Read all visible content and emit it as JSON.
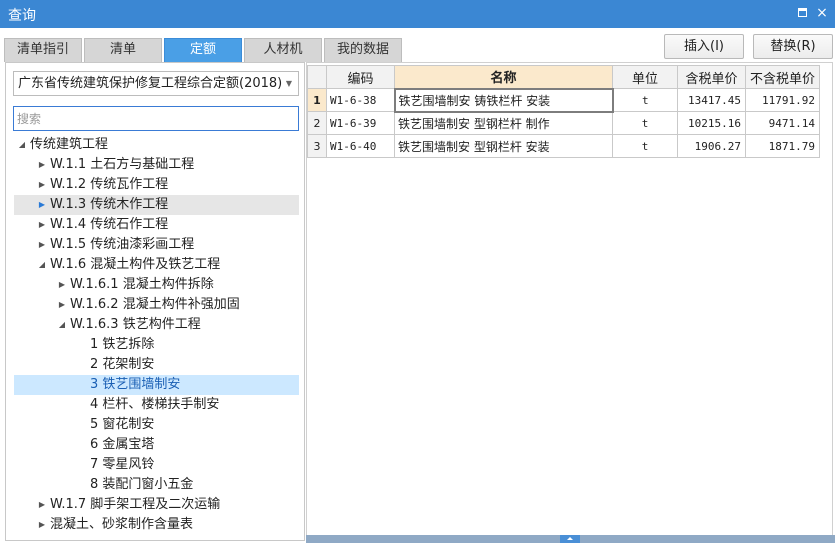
{
  "window": {
    "title": "查询",
    "close_glyph": "×"
  },
  "tabs": [
    {
      "label": "清单指引"
    },
    {
      "label": "清单"
    },
    {
      "label": "定额",
      "active": true
    },
    {
      "label": "人材机"
    },
    {
      "label": "我的数据"
    }
  ],
  "actions": {
    "insert_label": "插入(I)",
    "replace_label": "替换(R)"
  },
  "left": {
    "library": "广东省传统建筑保护修复工程综合定额(2018)",
    "search_placeholder": "搜索"
  },
  "tree": [
    {
      "label": "传统建筑工程",
      "level": 0,
      "state": "expanded"
    },
    {
      "label": "W.1.1 土石方与基础工程",
      "level": 1,
      "state": "collapsed"
    },
    {
      "label": "W.1.2 传统瓦作工程",
      "level": 1,
      "state": "collapsed"
    },
    {
      "label": "W.1.3 传统木作工程",
      "level": 1,
      "state": "collapsed-hover"
    },
    {
      "label": "W.1.4 传统石作工程",
      "level": 1,
      "state": "collapsed"
    },
    {
      "label": "W.1.5 传统油漆彩画工程",
      "level": 1,
      "state": "collapsed"
    },
    {
      "label": "W.1.6 混凝土构件及铁艺工程",
      "level": 1,
      "state": "expanded"
    },
    {
      "label": "W.1.6.1 混凝土构件拆除",
      "level": 2,
      "state": "collapsed"
    },
    {
      "label": "W.1.6.2 混凝土构件补强加固",
      "level": 2,
      "state": "collapsed"
    },
    {
      "label": "W.1.6.3 铁艺构件工程",
      "level": 2,
      "state": "expanded"
    },
    {
      "label": "1 铁艺拆除",
      "level": 3,
      "state": "leaf"
    },
    {
      "label": "2 花架制安",
      "level": 3,
      "state": "leaf"
    },
    {
      "label": "3 铁艺围墙制安",
      "level": 3,
      "state": "selected"
    },
    {
      "label": "4 栏杆、楼梯扶手制安",
      "level": 3,
      "state": "leaf"
    },
    {
      "label": "5 窗花制安",
      "level": 3,
      "state": "leaf"
    },
    {
      "label": "6 金属宝塔",
      "level": 3,
      "state": "leaf"
    },
    {
      "label": "7 零星风铃",
      "level": 3,
      "state": "leaf"
    },
    {
      "label": "8 装配门窗小五金",
      "level": 3,
      "state": "leaf"
    },
    {
      "label": "W.1.7 脚手架工程及二次运输",
      "level": 1,
      "state": "collapsed"
    },
    {
      "label": "混凝土、砂浆制作含量表",
      "level": 1,
      "state": "collapsed"
    }
  ],
  "table": {
    "columns": [
      "编码",
      "名称",
      "单位",
      "含税单价",
      "不含税单价"
    ],
    "rows": [
      {
        "num": "1",
        "code": "W1-6-38",
        "name": "铁艺围墙制安 铸铁栏杆 安装",
        "unit": "t",
        "price_tax": "13417.45",
        "price_notax": "11791.92"
      },
      {
        "num": "2",
        "code": "W1-6-39",
        "name": "铁艺围墙制安 型钢栏杆 制作",
        "unit": "t",
        "price_tax": "10215.16",
        "price_notax": "9471.14"
      },
      {
        "num": "3",
        "code": "W1-6-40",
        "name": "铁艺围墙制安 型钢栏杆 安装",
        "unit": "t",
        "price_tax": "1906.27",
        "price_notax": "1871.79"
      }
    ]
  },
  "colors": {
    "titlebar": "#3b87d3",
    "tab_active": "#4a9fe6",
    "selection": "#cce8ff",
    "header_highlight": "#fbe9cc"
  },
  "icons": [
    "maximize-icon",
    "close-icon",
    "dropdown-caret-icon",
    "expand-arrow-icon",
    "collapse-arrow-icon",
    "splitter-grip-icon"
  ]
}
